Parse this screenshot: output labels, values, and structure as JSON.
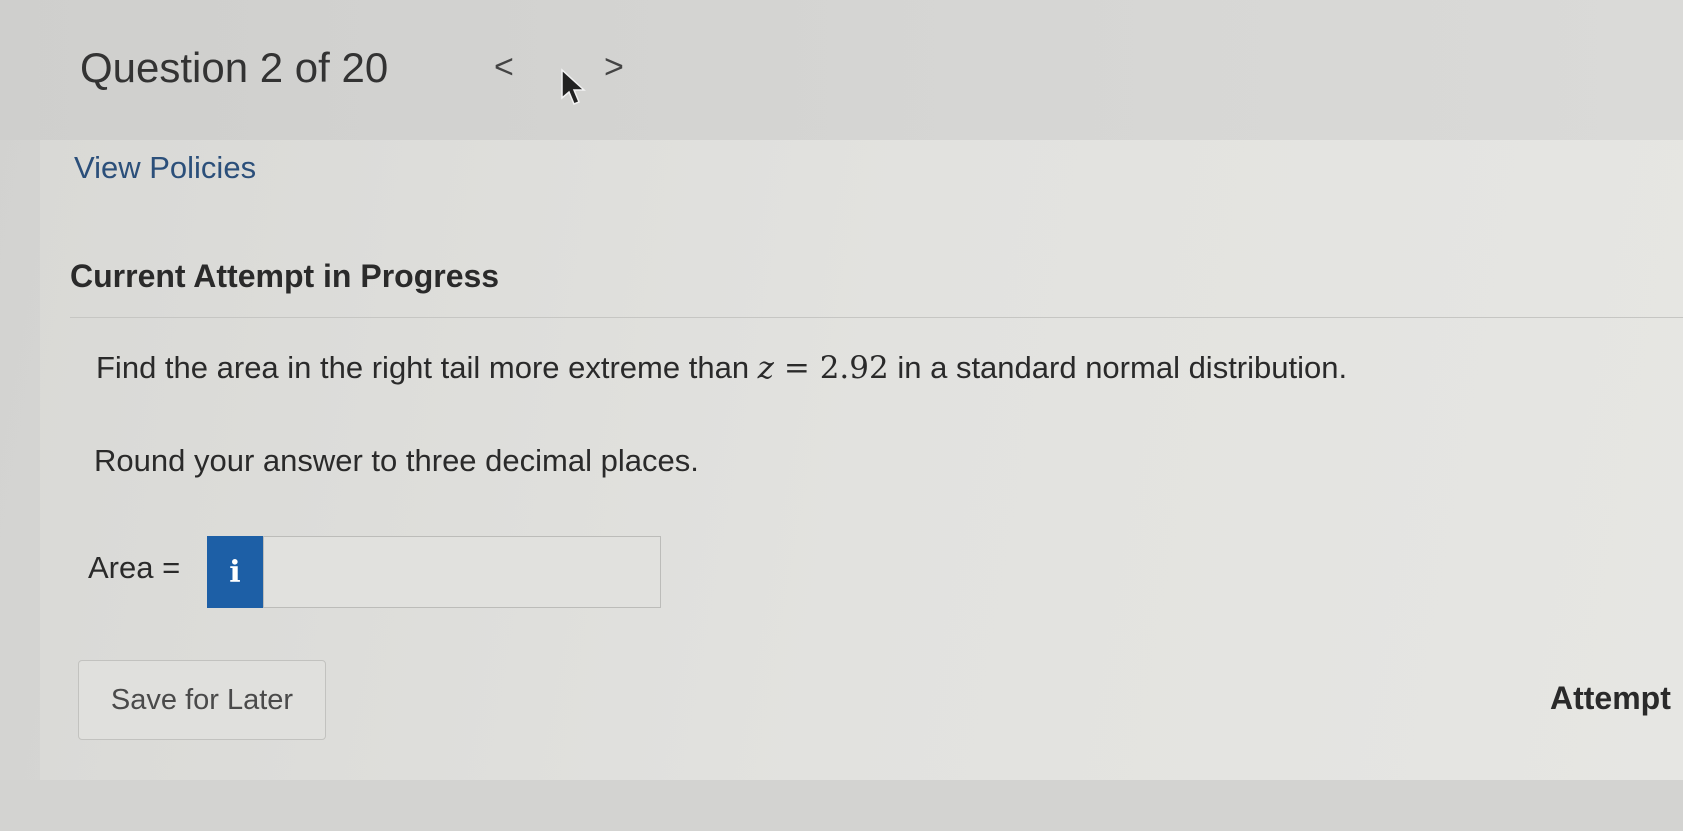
{
  "header": {
    "question_counter": "Question 2 of 20",
    "prev_glyph": "<",
    "next_glyph": ">"
  },
  "links": {
    "view_policies": "View Policies"
  },
  "attempt": {
    "heading": "Current Attempt in Progress"
  },
  "question": {
    "prefix": "Find the area in the right tail more extreme than ",
    "variable": "z",
    "operator": " = ",
    "value": "2.92",
    "suffix": " in a standard normal distribution.",
    "instruction": "Round your answer to three decimal places."
  },
  "answer": {
    "label": "Area =",
    "info_glyph": "i",
    "value": "",
    "placeholder": ""
  },
  "footer": {
    "save_label": "Save for Later",
    "attempts_label": "Attempt"
  },
  "colors": {
    "info_button": "#1d5fa6",
    "link": "#2b4f7a"
  }
}
